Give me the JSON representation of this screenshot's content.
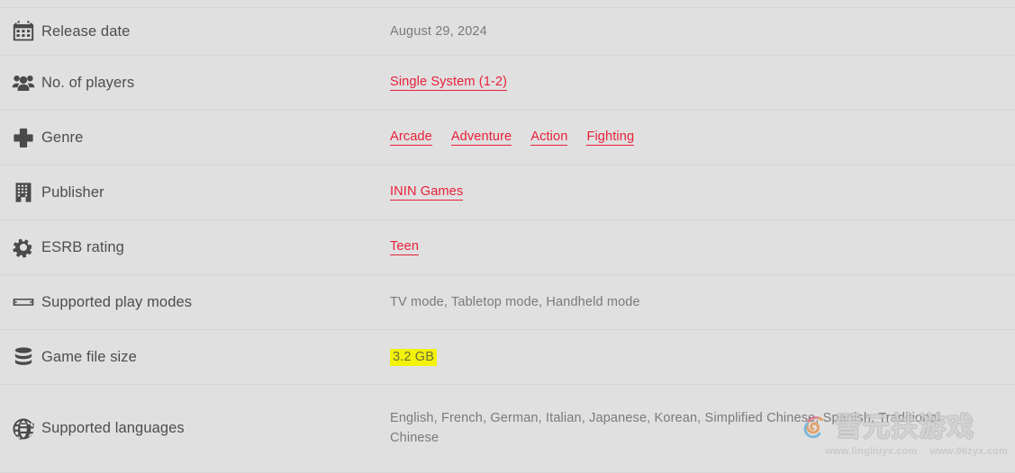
{
  "theme": {
    "background": "#e0e0e0",
    "divider": "#d6d6d6",
    "label_color": "#4d4d4d",
    "value_color": "#7a7a7a",
    "link_color": "#e8203a",
    "highlight_bg": "#f2f20a",
    "icon_color": "#4a4a4a"
  },
  "rows": [
    {
      "icon": "calendar-icon",
      "label": "Release date",
      "value": "August 29, 2024",
      "value_type": "text"
    },
    {
      "icon": "players-icon",
      "label": "No. of players",
      "value": "Single System (1-2)",
      "value_type": "link"
    },
    {
      "icon": "dpad-icon",
      "label": "Genre",
      "value_type": "link-list",
      "links": [
        "Arcade",
        "Adventure",
        "Action",
        "Fighting"
      ]
    },
    {
      "icon": "building-icon",
      "label": "Publisher",
      "value": "ININ Games",
      "value_type": "link"
    },
    {
      "icon": "gear-icon",
      "label": "ESRB rating",
      "value": "Teen",
      "value_type": "link"
    },
    {
      "icon": "handheld-console-icon",
      "label": "Supported play modes",
      "value": "TV mode, Tabletop mode, Handheld mode",
      "value_type": "text"
    },
    {
      "icon": "database-icon",
      "label": "Game file size",
      "value": "3.2 GB",
      "value_type": "highlight"
    },
    {
      "icon": "globe-icon",
      "label": "Supported languages",
      "value": "English, French, German, Italian, Japanese, Korean, Simplified Chinese, Spanish, Traditional Chinese",
      "value_type": "text"
    }
  ],
  "watermark": {
    "characters": "雪元扶游戏",
    "url_left": "www.lingliuyx.com",
    "url_right": "www.06zyx.com"
  }
}
